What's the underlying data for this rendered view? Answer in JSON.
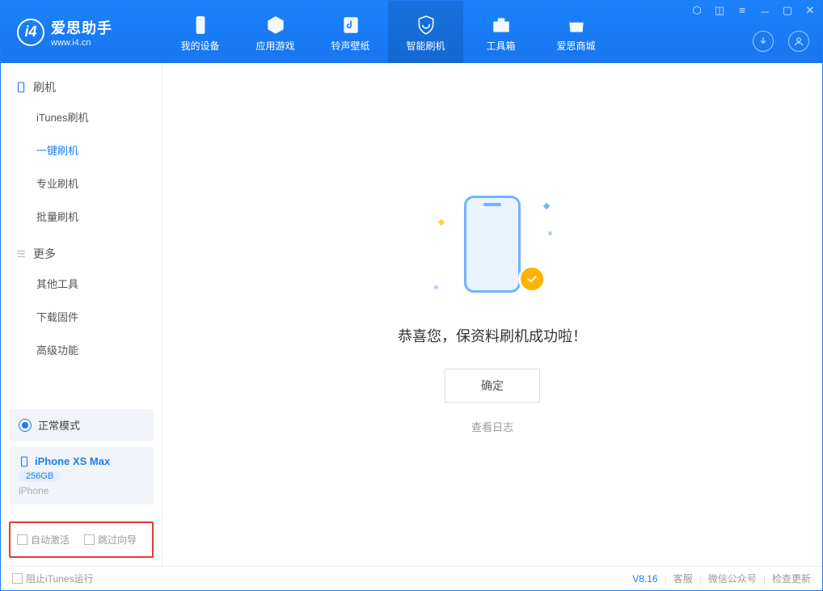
{
  "app": {
    "title": "爱思助手",
    "subtitle": "www.i4.cn"
  },
  "nav": {
    "items": [
      {
        "label": "我的设备"
      },
      {
        "label": "应用游戏"
      },
      {
        "label": "铃声壁纸"
      },
      {
        "label": "智能刷机"
      },
      {
        "label": "工具箱"
      },
      {
        "label": "爱思商城"
      }
    ],
    "active_index": 3
  },
  "sidebar": {
    "group1_title": "刷机",
    "group1_items": [
      "iTunes刷机",
      "一键刷机",
      "专业刷机",
      "批量刷机"
    ],
    "group1_active_index": 1,
    "group2_title": "更多",
    "group2_items": [
      "其他工具",
      "下载固件",
      "高级功能"
    ]
  },
  "device": {
    "mode": "正常模式",
    "name": "iPhone XS Max",
    "capacity": "256GB",
    "type": "iPhone"
  },
  "bottom_options": {
    "auto_activate": "自动激活",
    "skip_guide": "跳过向导"
  },
  "main": {
    "success_text": "恭喜您，保资料刷机成功啦！",
    "ok_button": "确定",
    "view_log": "查看日志"
  },
  "footer": {
    "block_itunes": "阻止iTunes运行",
    "version": "V8.16",
    "links": [
      "客服",
      "微信公众号",
      "检查更新"
    ]
  }
}
